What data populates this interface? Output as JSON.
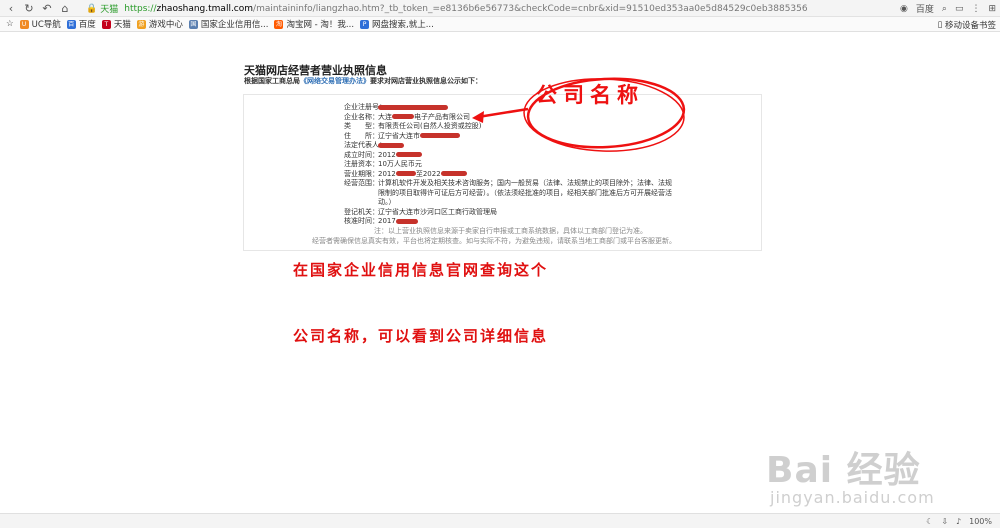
{
  "browser": {
    "site_label": "天猫",
    "url_https": "https://",
    "url_host": "zhaoshang.tmall.com",
    "url_path": "/maintaininfo/liangzhao.htm?_tb_token_=e8136b6e56773&checkCode=cnbr&xid=91510ed353aa0e5d84529c0eb3885356",
    "profile_label": "百度"
  },
  "bookmarks": [
    {
      "label": "UC导航",
      "color": "#f08a24",
      "glyph": "U"
    },
    {
      "label": "百度",
      "color": "#2f6fd8",
      "glyph": "百"
    },
    {
      "label": "天猫",
      "color": "#c4001b",
      "glyph": "T"
    },
    {
      "label": "游戏中心",
      "color": "#f0a020",
      "glyph": "游"
    },
    {
      "label": "国家企业信用信...",
      "color": "#5a7fb0",
      "glyph": "国"
    },
    {
      "label": "淘宝网 - 淘！我...",
      "color": "#ff5a00",
      "glyph": "淘"
    },
    {
      "label": "网盘搜索,就上...",
      "color": "#2f6fd8",
      "glyph": "P"
    }
  ],
  "mobile_bookmarks": "移动设备书签",
  "page": {
    "title": "天猫网店经营者营业执照信息",
    "subtitle_prefix": "根据国家工商总局",
    "subtitle_link": "《网络交易管理办法》",
    "subtitle_suffix": "要求对网店营业执照信息公示如下：",
    "rows": [
      {
        "k": "企业注册号：",
        "v": ""
      },
      {
        "k": "企业名称：",
        "v": "大连",
        "v2": "电子产品有限公司"
      },
      {
        "k": "类　　型：",
        "v": "有限责任公司(自然人投资或控股)"
      },
      {
        "k": "住　　所：",
        "v": "辽宁省大连市"
      },
      {
        "k": "法定代表人：",
        "v": ""
      },
      {
        "k": "成立时间：",
        "v": "2012"
      },
      {
        "k": "注册资本：",
        "v": "10万人民币元"
      },
      {
        "k": "营业期限：",
        "v": "2012",
        "v2": "至2022"
      },
      {
        "k": "经营范围：",
        "v": "计算机软件开发及相关技术咨询服务；国内一般贸易（法律、法规禁止的项目除外；法律、法规限制的项目取得许可证后方可经营）。（依法须经批准的项目，经相关部门批准后方可开展经营活动。）"
      },
      {
        "k": "登记机关：",
        "v": "辽宁省大连市沙河口区工商行政管理局"
      },
      {
        "k": "核准时间：",
        "v": "2017"
      }
    ],
    "note1": "注：以上营业执照信息来源于卖家自行申报或工商系统数据，具体以工商部门登记为准。",
    "note2": "经营者需确保信息真实有效，平台也将定期核查。如与实际不符，为避免违规，请联系当地工商部门或平台客服更新。"
  },
  "annotations": {
    "callout": "公司名称",
    "line1": "在国家企业信用信息官网查询这个",
    "line2": "公司名称，可以看到公司详细信息"
  },
  "watermark": {
    "brand": "Bai  经验",
    "url": "jingyan.baidu.com"
  },
  "statusbar": {
    "zoom": "100%"
  }
}
